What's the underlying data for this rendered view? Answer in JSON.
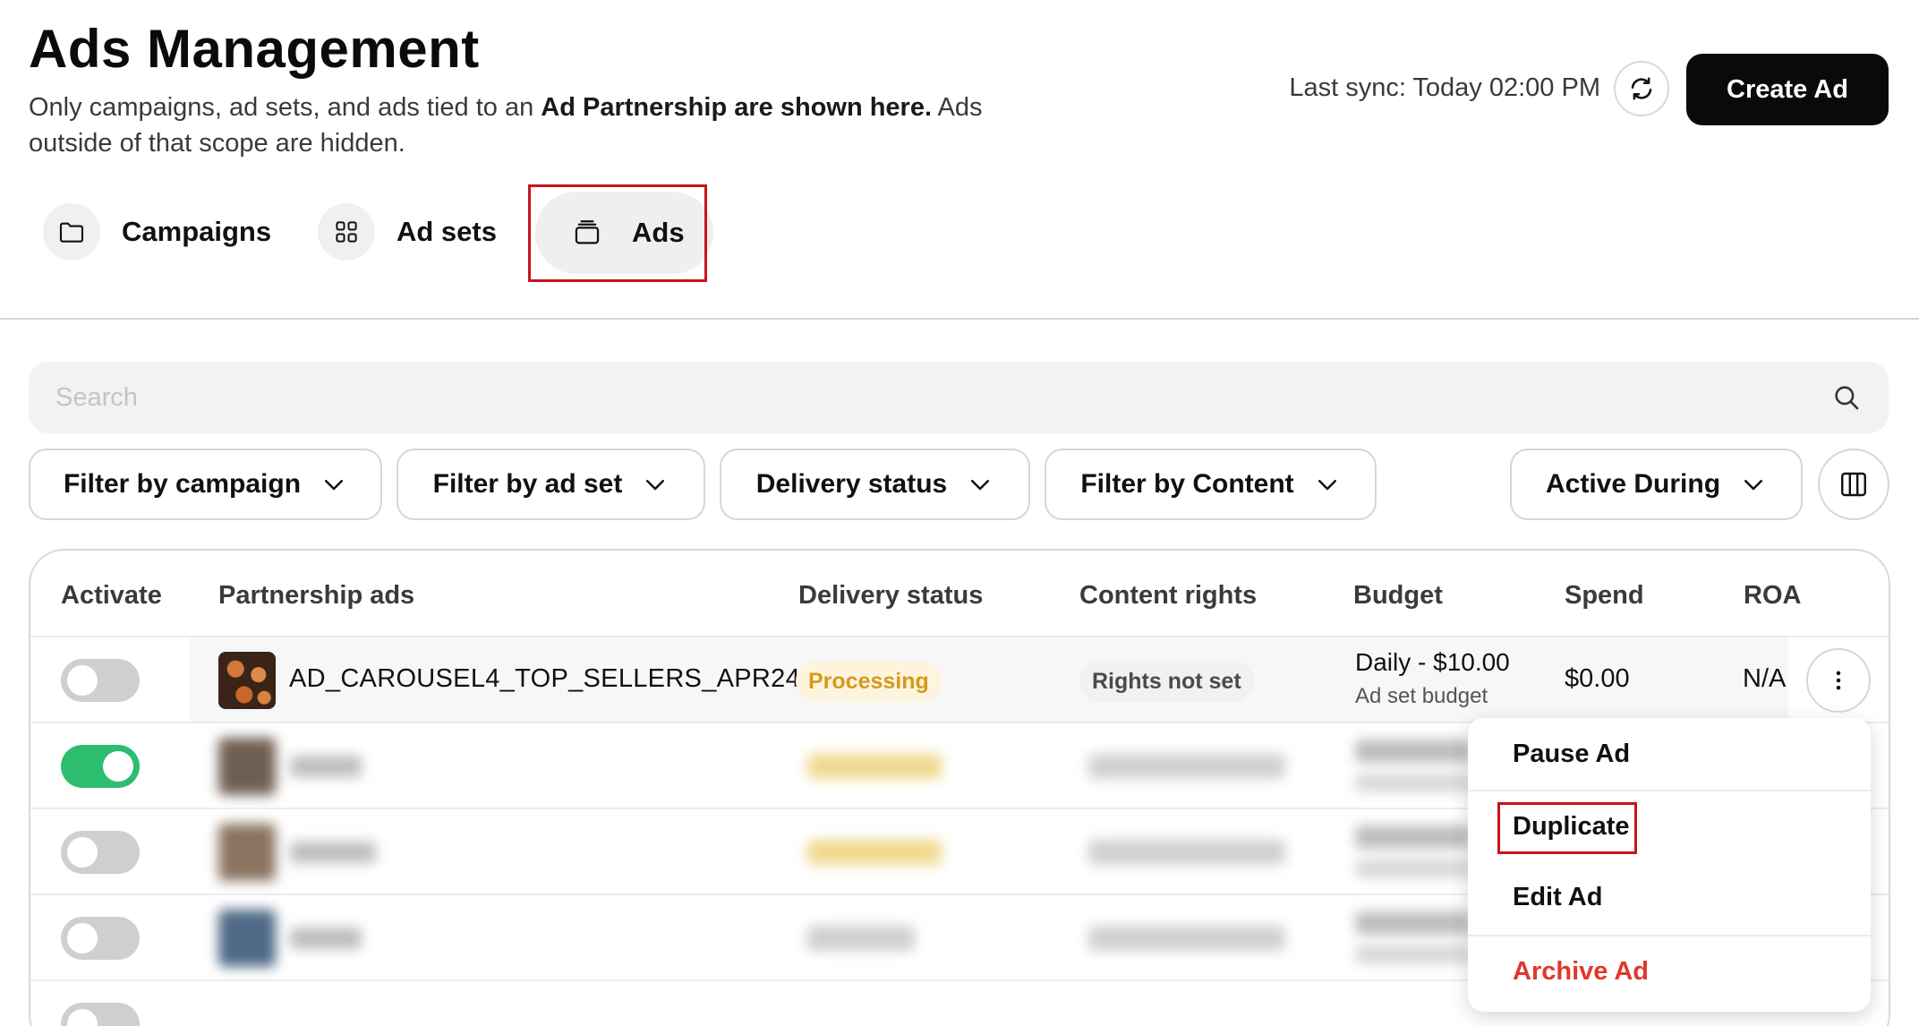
{
  "header": {
    "title": "Ads Management",
    "description_prefix": "Only campaigns, ad sets, and ads tied to an ",
    "description_bold": "Ad Partnership are shown here.",
    "description_suffix": " Ads outside of that scope are hidden.",
    "last_sync": "Last sync: Today 02:00 PM",
    "create_button": "Create Ad"
  },
  "tabs": [
    {
      "label": "Campaigns",
      "icon": "folder-icon"
    },
    {
      "label": "Ad sets",
      "icon": "grid-icon"
    },
    {
      "label": "Ads",
      "icon": "stack-icon",
      "active": true
    }
  ],
  "search": {
    "placeholder": "Search"
  },
  "filters": {
    "campaign": "Filter by campaign",
    "ad_set": "Filter by ad set",
    "delivery": "Delivery status",
    "content": "Filter by Content",
    "active_during": "Active During"
  },
  "table": {
    "columns": [
      "Activate",
      "Partnership ads",
      "Delivery status",
      "Content rights",
      "Budget",
      "Spend",
      "ROA"
    ],
    "rows": [
      {
        "active": false,
        "name": "AD_CAROUSEL4_TOP_SELLERS_APR24",
        "delivery_status": "Processing",
        "content_rights": "Rights not set",
        "budget": "Daily - $10.00",
        "budget_sub": "Ad set budget",
        "spend": "$0.00",
        "roas": "N/A"
      },
      {
        "active": true
      },
      {
        "active": false
      },
      {
        "active": false
      }
    ]
  },
  "row_menu": {
    "pause": "Pause Ad",
    "duplicate": "Duplicate",
    "edit": "Edit Ad",
    "archive": "Archive Ad"
  },
  "colors": {
    "accent": "#0a0a0a",
    "toggle_on": "#2dbd6e",
    "processing": "#d59a1b",
    "danger": "#e0382b",
    "highlight": "#c8141e"
  }
}
